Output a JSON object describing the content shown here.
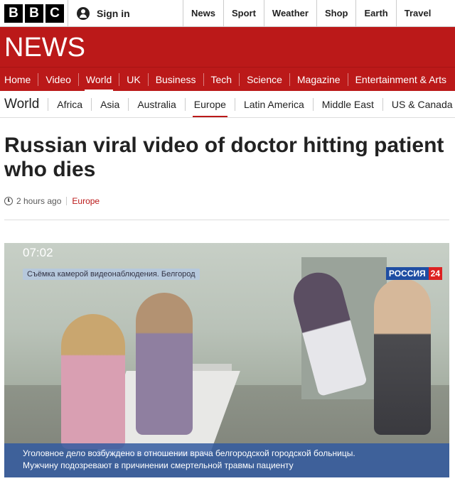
{
  "topbar": {
    "logo_letters": [
      "B",
      "B",
      "C"
    ],
    "signin_label": "Sign in",
    "nav": [
      "News",
      "Sport",
      "Weather",
      "Shop",
      "Earth",
      "Travel"
    ]
  },
  "banner": {
    "title": "NEWS"
  },
  "section_nav": {
    "items": [
      "Home",
      "Video",
      "World",
      "UK",
      "Business",
      "Tech",
      "Science",
      "Magazine",
      "Entertainment & Arts"
    ],
    "active": "World"
  },
  "sub_nav": {
    "section": "World",
    "items": [
      "Africa",
      "Asia",
      "Australia",
      "Europe",
      "Latin America",
      "Middle East",
      "US & Canada"
    ],
    "active": "Europe"
  },
  "article": {
    "headline": "Russian viral video of doctor hitting patient who dies",
    "timestamp": "2 hours ago",
    "category": "Europe"
  },
  "video": {
    "time_overlay": "07:02",
    "location_overlay": "Съёмка камерой видеонаблюдения. Белгород",
    "channel_name": "РОССИЯ",
    "channel_number": "24",
    "caption_line1": "Уголовное дело возбуждено в отношении врача белгородской городской больницы.",
    "caption_line2": "Мужчину подозревают в причинении смертельной травмы пациенту"
  }
}
